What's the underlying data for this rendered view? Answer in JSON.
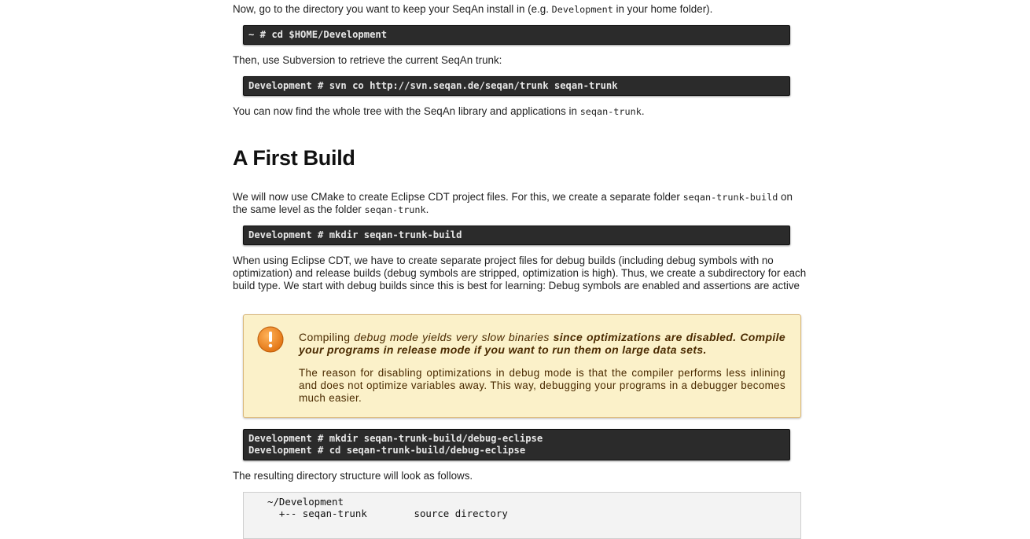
{
  "intro": {
    "p1_prefix": "Now, go to the directory you want to keep your SeqAn install in (e.g. ",
    "p1_code": "Development",
    "p1_suffix": " in your home folder).",
    "cmd1": "~ # cd $HOME/Development",
    "p2": "Then, use Subversion to retrieve the current SeqAn trunk:",
    "cmd2": "Development # svn co http://svn.seqan.de/seqan/trunk seqan-trunk",
    "p3_prefix": "You can now find the whole tree with the SeqAn library and applications in ",
    "p3_code": "seqan-trunk",
    "p3_suffix": "."
  },
  "section": {
    "heading": "A First Build",
    "p4_prefix": "We will now use CMake to create Eclipse CDT project files. For this, we create a separate folder ",
    "p4_code1": "seqan-trunk-build",
    "p4_mid": " on the same level as the folder ",
    "p4_code2": "seqan-trunk",
    "p4_suffix": ".",
    "cmd3": "Development # mkdir seqan-trunk-build",
    "p5": "When using Eclipse CDT, we have to create separate project files for debug builds (including debug symbols with no optimization) and release builds (debug symbols are stripped, optimization is high). Thus, we create a subdirectory for each build type. We start with debug builds since this is best for learning: Debug symbols are enabled and assertions are active"
  },
  "warning": {
    "icon": "exclamation-icon",
    "w_plain": "Compiling ",
    "w_italic": "debug mode yields very slow binaries",
    "w_bold_italic": " since optimizations are disabled. Compile your programs in release mode if you want to run them on large data sets.",
    "body": "The reason for disabling optimizations in debug mode is that the compiler performs less inlining and does not optimize variables away. This way, debugging your programs in a debugger becomes much easier."
  },
  "commands": {
    "cmd4": "Development # mkdir seqan-trunk-build/debug-eclipse",
    "cmd5": "Development # cd seqan-trunk-build/debug-eclipse"
  },
  "structure": {
    "p6": "The resulting directory structure will look as follows.",
    "rows": [
      "~/Development",
      "  +-- seqan-trunk        source directory"
    ]
  },
  "colors": {
    "terminal_bg": "#2b2b2b",
    "warning_bg": "#fbf1c9",
    "warning_icon": "#f08a1c"
  }
}
